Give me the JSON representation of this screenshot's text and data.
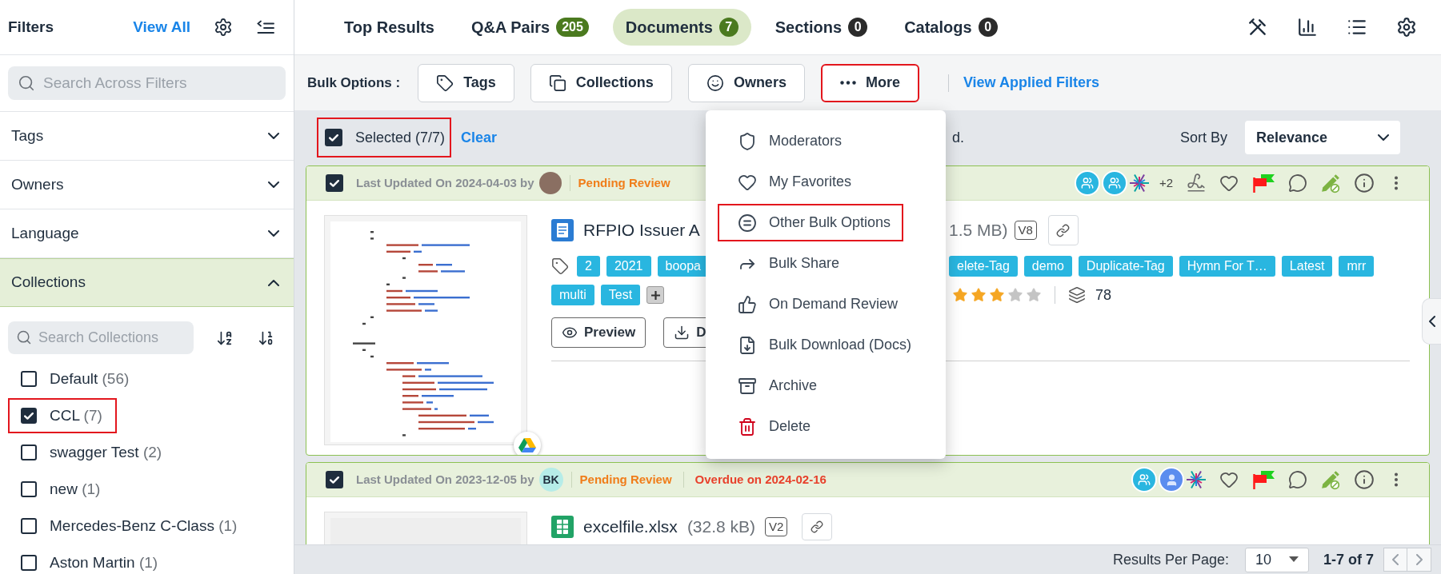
{
  "sidebar": {
    "title": "Filters",
    "view_all": "View All",
    "search": {
      "placeholder": "Search Across Filters"
    },
    "sections": [
      {
        "label": "Tags",
        "expanded": false
      },
      {
        "label": "Owners",
        "expanded": false
      },
      {
        "label": "Language",
        "expanded": false
      },
      {
        "label": "Collections",
        "expanded": true
      }
    ],
    "collections": {
      "search": {
        "placeholder": "Search Collections"
      },
      "items": [
        {
          "name": "Default",
          "count": "(56)",
          "checked": false,
          "highlighted": false
        },
        {
          "name": "CCL",
          "count": "(7)",
          "checked": true,
          "highlighted": true
        },
        {
          "name": "swagger Test",
          "count": "(2)",
          "checked": false,
          "highlighted": false
        },
        {
          "name": "new",
          "count": "(1)",
          "checked": false,
          "highlighted": false
        },
        {
          "name": "Mercedes-Benz C-Class",
          "count": "(1)",
          "checked": false,
          "highlighted": false
        },
        {
          "name": "Aston Martin",
          "count": "(1)",
          "checked": false,
          "highlighted": false
        }
      ]
    }
  },
  "tabs": [
    {
      "label": "Top Results",
      "selected": false
    },
    {
      "label": "Q&A Pairs",
      "count": "205",
      "color": "#4b7a1f",
      "selected": false
    },
    {
      "label": "Documents",
      "count": "7",
      "color": "#4b7a1f",
      "selected": true
    },
    {
      "label": "Sections",
      "count": "0",
      "color": "#2b2b2b",
      "selected": false
    },
    {
      "label": "Catalogs",
      "count": "0",
      "color": "#2b2b2b",
      "selected": false
    }
  ],
  "bulk_options": {
    "label": "Bulk Options :",
    "buttons": [
      {
        "label": "Tags",
        "highlighted": false
      },
      {
        "label": "Collections",
        "highlighted": false
      },
      {
        "label": "Owners",
        "highlighted": false
      },
      {
        "label": "More",
        "highlighted": true
      }
    ],
    "link": "View Applied Filters"
  },
  "selection": {
    "checked": true,
    "label": "Selected (7/7)",
    "highlighted": true,
    "clear": "Clear",
    "notice_tail": "d."
  },
  "sort": {
    "label": "Sort By",
    "value": "Relevance"
  },
  "more_menu": {
    "items": [
      {
        "label": "Moderators",
        "highlighted": false,
        "danger": false
      },
      {
        "label": "My Favorites",
        "highlighted": false,
        "danger": false
      },
      {
        "label": "Other Bulk Options",
        "highlighted": true,
        "danger": false
      },
      {
        "label": "Bulk Share",
        "highlighted": false,
        "danger": false
      },
      {
        "label": "On Demand Review",
        "highlighted": false,
        "danger": false
      },
      {
        "label": "Bulk Download (Docs)",
        "highlighted": false,
        "danger": false
      },
      {
        "label": "Archive",
        "highlighted": false,
        "danger": false
      },
      {
        "label": "Delete",
        "highlighted": false,
        "danger": true
      }
    ]
  },
  "documents": [
    {
      "checked": true,
      "updated": "Last Updated On 2024-04-03 by",
      "avatar": {
        "kind": "photo"
      },
      "status": "Pending Review",
      "participants": [
        {
          "kind": "group"
        },
        {
          "kind": "group"
        },
        {
          "kind": "logo"
        }
      ],
      "more_participants": "+2",
      "signature": true,
      "thumbnail": {
        "kind": "document"
      },
      "file": {
        "kind": "word",
        "title": "RFPIO Issuer A",
        "size": "1.5 MB)",
        "version": "V8"
      },
      "tags": {
        "before_menu": [
          "2",
          "2021",
          "boopa"
        ],
        "after_menu": [
          "elete-Tag",
          "demo",
          "Duplicate-Tag",
          "Hymn For T…",
          "Latest",
          "mrr"
        ]
      },
      "tags_second_row": [
        "multi",
        "Test"
      ],
      "stars": 3,
      "count": "78",
      "actions": [
        {
          "kind": "preview",
          "label": "Preview"
        },
        {
          "kind": "download",
          "label": "D"
        }
      ]
    },
    {
      "checked": true,
      "updated": "Last Updated On 2023-12-05 by",
      "avatar": {
        "kind": "initials",
        "text": "BK"
      },
      "status": "Pending Review",
      "overdue": "Overdue on 2024-02-16",
      "participants": [
        {
          "kind": "group"
        },
        {
          "kind": "person"
        },
        {
          "kind": "logo"
        }
      ],
      "signature": false,
      "thumbnail": {
        "kind": "blank"
      },
      "file": {
        "kind": "excel",
        "title": "excelfile.xlsx",
        "size": "(32.8 kB)",
        "version": "V2"
      }
    }
  ],
  "footer": {
    "label": "Results Per Page:",
    "per_page": "10",
    "range": "1-7 of 7"
  }
}
